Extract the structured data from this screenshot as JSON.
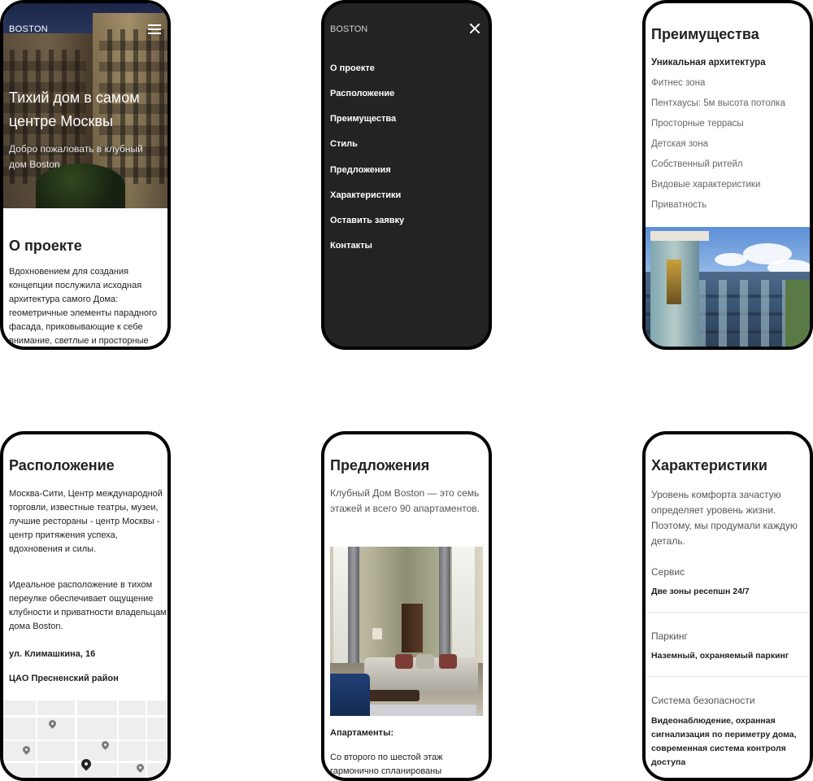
{
  "screen1": {
    "brand": "BOSTON",
    "hero_title": "Тихий дом в самом центре Москвы",
    "hero_subtitle": "Добро пожаловать в клубный дом Boston",
    "section_title": "О проекте",
    "section_text": "Вдохновением для создания концепции послужила исходная архитектура самого Дома: геометричные элементы парадного фасада, приковывающие к себе внимание, светлые и просторные"
  },
  "screen2": {
    "brand": "BOSTON",
    "menu": [
      "О проекте",
      "Расположение",
      "Преимущества",
      "Стиль",
      "Предложения",
      "Характеристики",
      "Оставить заявку",
      "Контакты"
    ]
  },
  "screen3": {
    "title": "Преимущества",
    "items": [
      "Уникальная архитектура",
      "Фитнес зона",
      "Пентхаусы: 5м высота потолка",
      "Просторные террасы",
      "Детская зона",
      "Собственный ритейл",
      "Видовые характеристики",
      "Приватность"
    ]
  },
  "screen4": {
    "title": "Расположение",
    "paragraph1": "Москва-Сити, Центр международной торговли, известные театры, музеи, лучшие рестораны - центр Москвы - центр притяжения успеха, вдохновения и силы.",
    "paragraph2": "Идеальное расположение в тихом переулке обеспечивает ощущение клубности и приватности владельцам дома Boston.",
    "address": "ул. Климашкина, 16",
    "district": "ЦАО Пресненский район"
  },
  "screen5": {
    "title": "Предложения",
    "intro": "Клубный Дом Boston — это семь этажей и всего 90 апартаментов.",
    "subtitle": "Апартаменты:",
    "text": "Со второго по шестой этаж гармонично спланированы"
  },
  "screen6": {
    "title": "Характеристики",
    "intro": "Уровень комфорта зачастую определяет уровень жизни. Поэтому, мы продумали каждую деталь.",
    "features": [
      {
        "label": "Сервис",
        "value": "Две зоны ресепшн 24/7"
      },
      {
        "label": "Паркинг",
        "value": "Наземный, охраняемый паркинг"
      },
      {
        "label": "Система безопасности",
        "value": "Видеонаблюдение, охранная сигнализация по периметру дома, современная система контроля доступа"
      }
    ]
  }
}
